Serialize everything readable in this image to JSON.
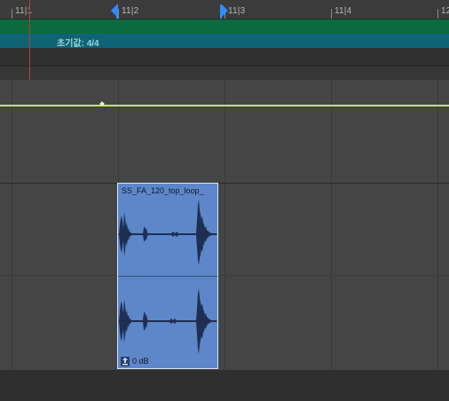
{
  "ruler": {
    "bars": [
      "11|1",
      "11|2",
      "11|3",
      "11|4",
      "12"
    ]
  },
  "global_tracks": {
    "signature_label": "초기값: 4/4"
  },
  "region": {
    "name": "SS_FA_120_top_loop_",
    "gain": "0 dB"
  },
  "colors": {
    "tempo_track": "#0d6a3f",
    "signature_track": "#0e6475",
    "region_fill": "#5d87c9",
    "automation_line": "#c8e65a",
    "playhead": "#c23a2e",
    "locator": "#2f8cff"
  },
  "icons": {
    "region_gain": "gain-icon",
    "locators": "cycle-locator-icon"
  }
}
